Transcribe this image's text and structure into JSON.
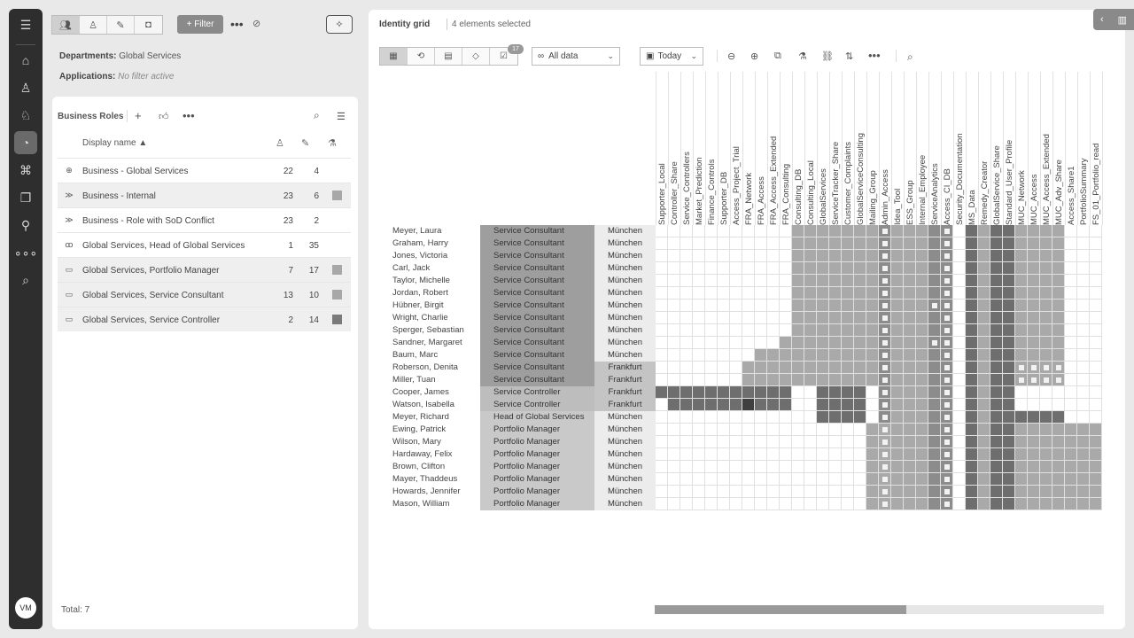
{
  "user": {
    "initials": "VM"
  },
  "toolbar": {
    "filter_label": "+ Filter",
    "more": "•••"
  },
  "filters": {
    "departments_label": "Departments:",
    "departments_value": "Global Services",
    "applications_label": "Applications:",
    "applications_value": "No filter active"
  },
  "business_roles": {
    "title": "Business Roles",
    "column_display_name": "Display name",
    "total": "Total: 7",
    "rows": [
      {
        "name": "Business - Global Services",
        "n1": "22",
        "n2": "4",
        "icon": "plus-circle-icon",
        "square": ""
      },
      {
        "name": "Business - Internal",
        "n1": "23",
        "n2": "6",
        "icon": "chevrons-icon",
        "square": "#a8a8a8"
      },
      {
        "name": "Business - Role with SoD Conflict",
        "n1": "23",
        "n2": "2",
        "icon": "chevrons-icon",
        "square": ""
      },
      {
        "name": "Global Services, Head of Global Services",
        "n1": "1",
        "n2": "35",
        "icon": "people-icon",
        "square": ""
      },
      {
        "name": "Global Services, Portfolio Manager",
        "n1": "7",
        "n2": "17",
        "icon": "new-icon",
        "square": "#a8a8a8"
      },
      {
        "name": "Global Services, Service Consultant",
        "n1": "13",
        "n2": "10",
        "icon": "new-icon",
        "square": "#a8a8a8"
      },
      {
        "name": "Global Services, Service Controller",
        "n1": "2",
        "n2": "14",
        "icon": "new-icon",
        "square": "#7a7a7a"
      }
    ]
  },
  "identity_grid": {
    "title": "Identity grid",
    "selected": "4 elements selected",
    "badge": "17",
    "data_dropdown": "All data",
    "date_dropdown": "Today",
    "columns": [
      "Supporter_Local",
      "Controller_Share",
      "Service_Controllers",
      "Market_Prediction",
      "Finance_Controls",
      "Supporter_DB",
      "Access_Project_Trial",
      "FRA_Network",
      "FRA_Access",
      "FRA_Access_Extended",
      "FRA_Consulting",
      "Consulting_DB",
      "Consulting_Local",
      "GlobalServices",
      "ServiceTracker_Share",
      "Customer_Complaints",
      "GlobalServiceConsulting",
      "Mailing_Group",
      "Admin_Access",
      "Idea_Tool",
      "ESS_Group",
      "Internal_Employee",
      "ServiceAnalytics",
      "Access_CI_DB",
      "Security_Documentation",
      "MS_Data",
      "Remedy_Creator",
      "GlobalService_Share",
      "Standard_User_Profile",
      "MUC_Network",
      "MUC_Access",
      "MUC_Access_Extended",
      "MUC_Adv_Share",
      "Access_Share1",
      "PortfolioSummary",
      "FS_01_Portfolio_read"
    ],
    "rows": [
      {
        "name": "Meyer, Laura",
        "role": "Service Consultant",
        "location": "München"
      },
      {
        "name": "Graham, Harry",
        "role": "Service Consultant",
        "location": "München"
      },
      {
        "name": "Jones, Victoria",
        "role": "Service Consultant",
        "location": "München"
      },
      {
        "name": "Carl, Jack",
        "role": "Service Consultant",
        "location": "München"
      },
      {
        "name": "Taylor, Michelle",
        "role": "Service Consultant",
        "location": "München"
      },
      {
        "name": "Jordan, Robert",
        "role": "Service Consultant",
        "location": "München"
      },
      {
        "name": "Hübner, Birgit",
        "role": "Service Consultant",
        "location": "München"
      },
      {
        "name": "Wright, Charlie",
        "role": "Service Consultant",
        "location": "München"
      },
      {
        "name": "Sperger, Sebastian",
        "role": "Service Consultant",
        "location": "München"
      },
      {
        "name": "Sandner, Margaret",
        "role": "Service Consultant",
        "location": "München"
      },
      {
        "name": "Baum, Marc",
        "role": "Service Consultant",
        "location": "München"
      },
      {
        "name": "Roberson, Denita",
        "role": "Service Consultant",
        "location": "Frankfurt"
      },
      {
        "name": "Miller, Tuan",
        "role": "Service Consultant",
        "location": "Frankfurt"
      },
      {
        "name": "Cooper, James",
        "role": "Service Controller",
        "location": "Frankfurt"
      },
      {
        "name": "Watson, Isabella",
        "role": "Service Controller",
        "location": "Frankfurt"
      },
      {
        "name": "Meyer, Richard",
        "role": "Head of Global Services",
        "location": "München"
      },
      {
        "name": "Ewing, Patrick",
        "role": "Portfolio Manager",
        "location": "München"
      },
      {
        "name": "Wilson, Mary",
        "role": "Portfolio Manager",
        "location": "München"
      },
      {
        "name": "Hardaway, Felix",
        "role": "Portfolio Manager",
        "location": "München"
      },
      {
        "name": "Brown, Clifton",
        "role": "Portfolio Manager",
        "location": "München"
      },
      {
        "name": "Mayer, Thaddeus",
        "role": "Portfolio Manager",
        "location": "München"
      },
      {
        "name": "Howards, Jennifer",
        "role": "Portfolio Manager",
        "location": "München"
      },
      {
        "name": "Mason, William",
        "role": "Portfolio Manager",
        "location": "München"
      }
    ]
  }
}
